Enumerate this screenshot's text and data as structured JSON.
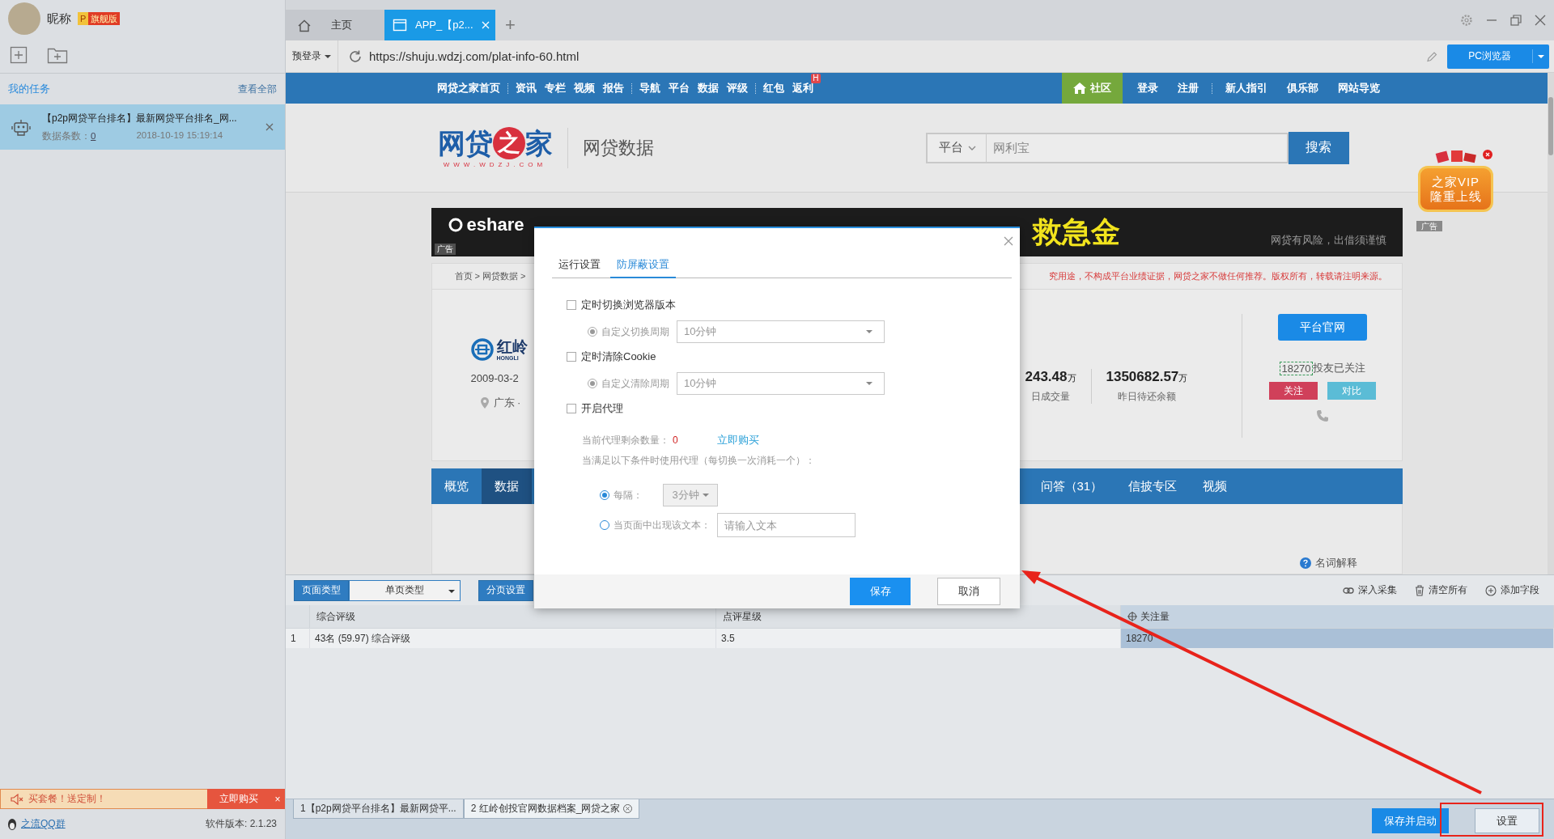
{
  "sidebar": {
    "user": {
      "nickname": "昵称",
      "badge_letter": "P",
      "badge": "旗舰版"
    },
    "tasks_header": {
      "title": "我的任务",
      "link": "查看全部"
    },
    "tasks": [
      {
        "title": "【p2p网贷平台排名】最新网贷平台排名_网...",
        "count_label": "数据条数：",
        "count": "0",
        "time": "2018-10-19 15:19:14",
        "selected": true
      }
    ],
    "promo": {
      "text": "买套餐！送定制！",
      "button": "立即购买",
      "close": "×"
    },
    "footer": {
      "link": "之流QQ群",
      "version": "软件版本: 2.1.23"
    }
  },
  "browser": {
    "tabs": [
      {
        "kind": "home",
        "label": "主页",
        "selected": false
      },
      {
        "kind": "page",
        "label": "APP_【p2...",
        "selected": true
      }
    ],
    "new_tab": "+",
    "address_bar": {
      "login": "预登录",
      "url": "https://shuju.wdzj.com/plat-info-60.html",
      "mode_button": "PC浏览器"
    }
  },
  "page": {
    "nav": {
      "left_groups": [
        [
          {
            "label": "网贷之家首页"
          }
        ],
        [
          {
            "label": "资讯"
          },
          {
            "label": "专栏"
          },
          {
            "label": "视频"
          },
          {
            "label": "报告"
          }
        ],
        [
          {
            "label": "导航"
          },
          {
            "label": "平台"
          },
          {
            "label": "数据"
          },
          {
            "label": "评级"
          }
        ],
        [
          {
            "label": "红包"
          },
          {
            "label": "返利",
            "badge": "H"
          }
        ]
      ],
      "community": {
        "label": "社区",
        "selected": true
      },
      "right_groups": [
        [
          {
            "label": "登录"
          },
          {
            "label": "注册"
          }
        ],
        [
          {
            "label": "新人指引"
          },
          {
            "label": "俱乐部"
          },
          {
            "label": "网站导览"
          }
        ]
      ]
    },
    "header": {
      "logo_parts": [
        "网贷",
        "之",
        "家"
      ],
      "logo_url": "WWW.WDZJ.COM",
      "section": "网贷数据",
      "search": {
        "scope": "平台",
        "placeholder": "网利宝",
        "button": "搜索"
      }
    },
    "vip_ad": {
      "lines": [
        "之家VIP",
        "隆重上线"
      ],
      "ad_label": "广告"
    },
    "banner": {
      "brand": "eshare",
      "headline": "救急金",
      "notice": "网贷有风险，出借须谨慎",
      "ad_label": "广告"
    },
    "breadcrumb": "首页 > 网贷数据 >",
    "disclaimer": "究用途，不构成平台业绩证据，网贷之家不做任何推荐。版权所有，转载请注明来源。",
    "platform": {
      "name": "红岭",
      "name_en": "HONGLI",
      "date": "2009-03-2",
      "region": "广东 ·",
      "stats": [
        {
          "value": "243.48",
          "unit": "万",
          "label": "日成交量"
        },
        {
          "value": "1350682.57",
          "unit": "万",
          "label": "昨日待还余额"
        }
      ],
      "site_button": "平台官网",
      "followers": "18270",
      "followers_label": "投友已关注",
      "follow_button": "关注",
      "compare_button": "对比"
    },
    "tabs": [
      {
        "label": "概览",
        "selected": false
      },
      {
        "label": "数据",
        "selected": true
      },
      {
        "label": "问答（31）",
        "selected": false
      },
      {
        "label": "信披专区",
        "selected": false
      },
      {
        "label": "视频",
        "selected": false
      }
    ],
    "glossary": "名词解释"
  },
  "collector": {
    "toolbar": {
      "page_type_label": "页面类型",
      "page_type": "单页类型",
      "pagination": "分页设置",
      "actions": [
        {
          "kind": "deep",
          "label": "深入采集"
        },
        {
          "kind": "clear",
          "label": "清空所有"
        },
        {
          "kind": "add",
          "label": "添加字段"
        }
      ]
    },
    "table": {
      "columns": [
        {
          "label": "综合评级",
          "selected": false
        },
        {
          "label": "点评星级",
          "selected": false
        },
        {
          "label": "关注量",
          "selected": true
        }
      ],
      "rows": [
        {
          "index": "1",
          "cells": [
            "43名 (59.97) 综合评级",
            "3.5",
            "18270"
          ]
        }
      ]
    }
  },
  "bottom_bar": {
    "task_tabs": [
      {
        "label": "1【p2p网贷平台排名】最新网贷平...",
        "selected": false
      },
      {
        "label": "2 红岭创投官网数据档案_网贷之家",
        "selected": true
      }
    ],
    "buttons": [
      {
        "kind": "primary",
        "label": "保存并启动"
      },
      {
        "kind": "default",
        "label": "设置"
      }
    ]
  },
  "dialog": {
    "tabs": [
      {
        "label": "运行设置",
        "selected": false
      },
      {
        "label": "防屏蔽设置",
        "selected": true
      }
    ],
    "options": [
      {
        "kind": "checkbox",
        "label": "定时切换浏览器版本",
        "checked": false
      },
      {
        "kind": "period",
        "label": "自定义切换周期",
        "selected": true,
        "disabled": true,
        "value": "10分钟"
      },
      {
        "kind": "checkbox",
        "label": "定时清除Cookie",
        "checked": false
      },
      {
        "kind": "period",
        "label": "自定义清除周期",
        "selected": true,
        "disabled": true,
        "value": "10分钟"
      },
      {
        "kind": "checkbox",
        "label": "开启代理",
        "checked": false
      },
      {
        "kind": "remaining",
        "label": "当前代理剩余数量：",
        "count": "0",
        "link": "立即购买"
      },
      {
        "kind": "note",
        "label": "当满足以下条件时使用代理（每切换一次消耗一个）："
      },
      {
        "kind": "interval",
        "label": "每隔：",
        "selected": true,
        "value": "3分钟"
      },
      {
        "kind": "text_trigger",
        "label": "当页面中出现该文本：",
        "selected": false,
        "placeholder": "请输入文本"
      }
    ],
    "buttons": {
      "save": "保存",
      "cancel": "取消"
    }
  }
}
